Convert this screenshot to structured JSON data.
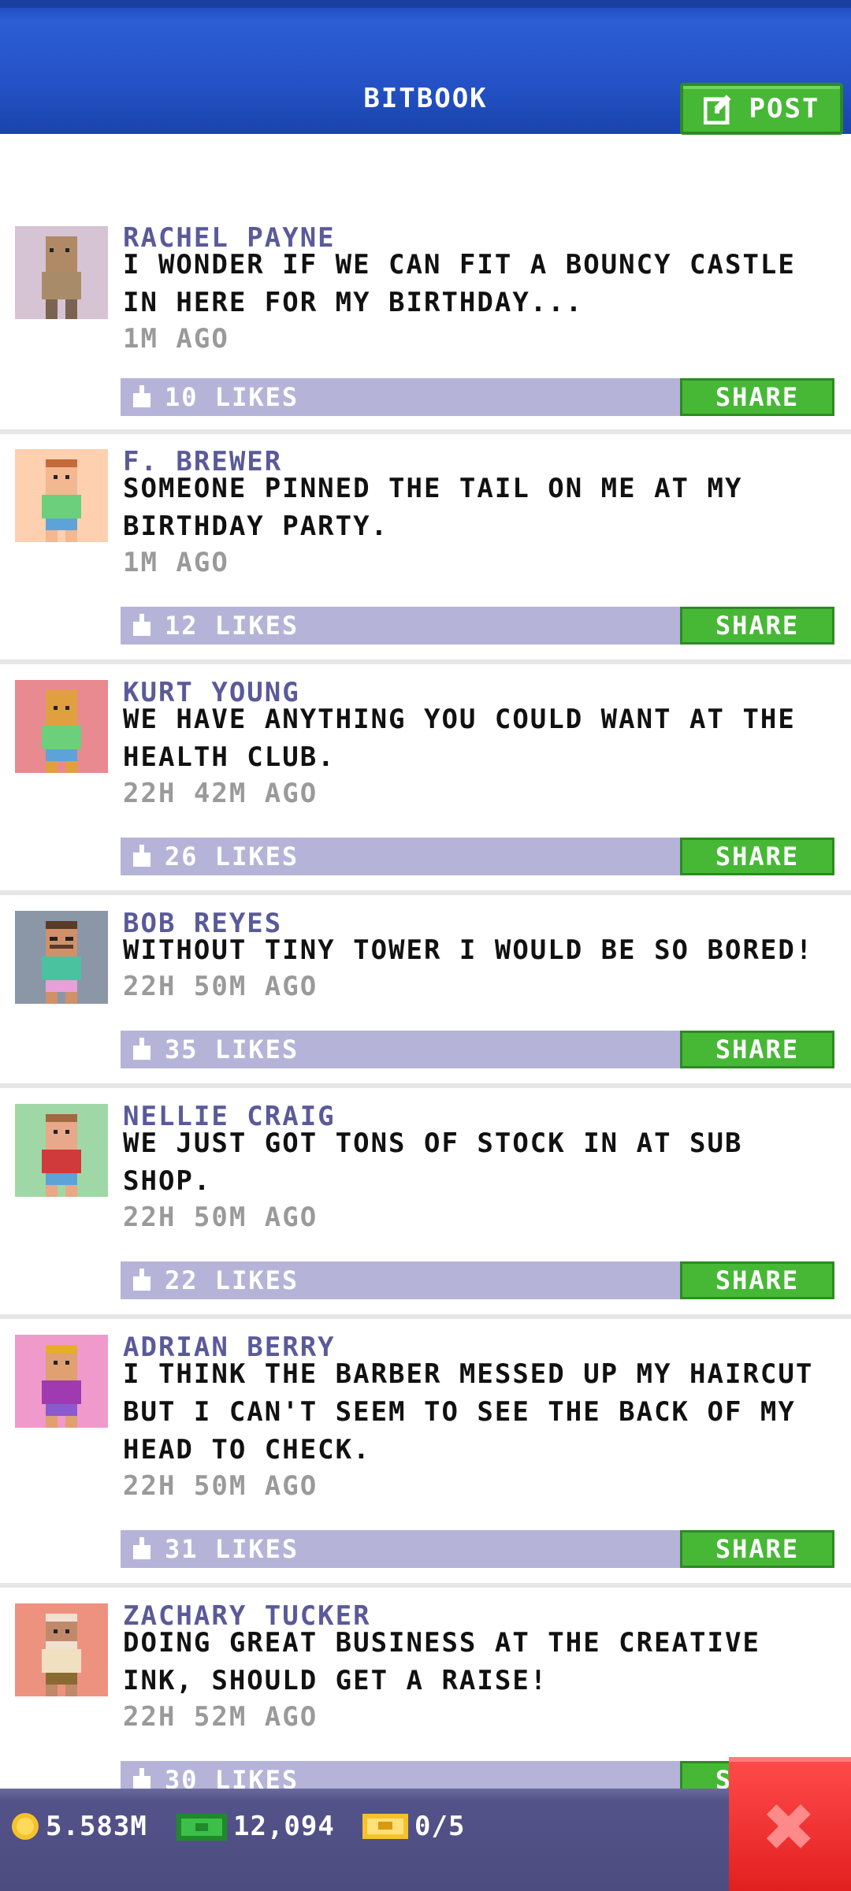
{
  "header": {
    "title": "BITBOOK",
    "post_label": "POST"
  },
  "posts": [
    {
      "name": "RACHEL PAYNE",
      "text": "I WONDER IF WE CAN FIT A BOUNCY CASTLE IN HERE FOR MY BIRTHDAY...",
      "time": "1M AGO",
      "likes": "10 LIKES",
      "share": "SHARE"
    },
    {
      "name": "F. BREWER",
      "text": "SOMEONE PINNED THE TAIL ON ME AT MY BIRTHDAY PARTY.",
      "time": "1M AGO",
      "likes": "12 LIKES",
      "share": "SHARE"
    },
    {
      "name": "KURT YOUNG",
      "text": "WE HAVE ANYTHING YOU COULD WANT AT THE HEALTH CLUB.",
      "time": "22H 42M AGO",
      "likes": "26 LIKES",
      "share": "SHARE"
    },
    {
      "name": "BOB REYES",
      "text": "WITHOUT TINY TOWER I WOULD BE SO BORED!",
      "time": "22H 50M AGO",
      "likes": "35 LIKES",
      "share": "SHARE"
    },
    {
      "name": "NELLIE CRAIG",
      "text": "WE JUST GOT TONS OF STOCK IN AT SUB SHOP.",
      "time": "22H 50M AGO",
      "likes": "22 LIKES",
      "share": "SHARE"
    },
    {
      "name": "ADRIAN BERRY",
      "text": "I THINK THE BARBER MESSED UP MY HAIRCUT BUT I CAN'T SEEM TO SEE THE BACK OF MY HEAD TO CHECK.",
      "time": "22H 50M AGO",
      "likes": "31 LIKES",
      "share": "SHARE"
    },
    {
      "name": "ZACHARY TUCKER",
      "text": "DOING GREAT BUSINESS AT THE CREATIVE INK, SHOULD GET A RAISE!",
      "time": "22H 52M AGO",
      "likes": "30 LIKES",
      "share": "SHARE"
    }
  ],
  "status_bar": {
    "coins": "5.583M",
    "bux": "12,094",
    "tickets": "0/5"
  },
  "colors": {
    "header_blue": "#2452c6",
    "share_green": "#46b836",
    "like_bar": "#b5b4d8",
    "name_purple": "#5a5a9a",
    "close_red": "#e21f1f",
    "avatar_bgs": [
      "#d6c4d4",
      "#ffd0b0",
      "#e88a90",
      "#8b96a6",
      "#9fd8a6",
      "#f09acb",
      "#ee9280"
    ]
  },
  "icons": [
    "edit-icon",
    "thumbs-up-icon",
    "coin-icon",
    "bux-icon",
    "ticket-icon",
    "close-icon"
  ]
}
